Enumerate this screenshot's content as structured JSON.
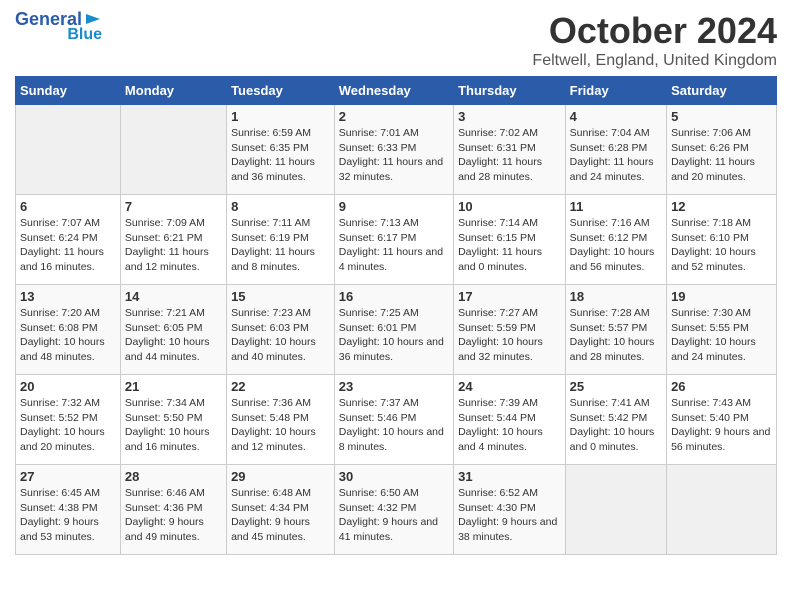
{
  "header": {
    "logo_line1": "General",
    "logo_line2": "Blue",
    "title": "October 2024",
    "subtitle": "Feltwell, England, United Kingdom"
  },
  "weekdays": [
    "Sunday",
    "Monday",
    "Tuesday",
    "Wednesday",
    "Thursday",
    "Friday",
    "Saturday"
  ],
  "weeks": [
    [
      {
        "day": "",
        "empty": true
      },
      {
        "day": "",
        "empty": true
      },
      {
        "day": "1",
        "sunrise": "6:59 AM",
        "sunset": "6:35 PM",
        "daylight": "11 hours and 36 minutes."
      },
      {
        "day": "2",
        "sunrise": "7:01 AM",
        "sunset": "6:33 PM",
        "daylight": "11 hours and 32 minutes."
      },
      {
        "day": "3",
        "sunrise": "7:02 AM",
        "sunset": "6:31 PM",
        "daylight": "11 hours and 28 minutes."
      },
      {
        "day": "4",
        "sunrise": "7:04 AM",
        "sunset": "6:28 PM",
        "daylight": "11 hours and 24 minutes."
      },
      {
        "day": "5",
        "sunrise": "7:06 AM",
        "sunset": "6:26 PM",
        "daylight": "11 hours and 20 minutes."
      }
    ],
    [
      {
        "day": "6",
        "sunrise": "7:07 AM",
        "sunset": "6:24 PM",
        "daylight": "11 hours and 16 minutes."
      },
      {
        "day": "7",
        "sunrise": "7:09 AM",
        "sunset": "6:21 PM",
        "daylight": "11 hours and 12 minutes."
      },
      {
        "day": "8",
        "sunrise": "7:11 AM",
        "sunset": "6:19 PM",
        "daylight": "11 hours and 8 minutes."
      },
      {
        "day": "9",
        "sunrise": "7:13 AM",
        "sunset": "6:17 PM",
        "daylight": "11 hours and 4 minutes."
      },
      {
        "day": "10",
        "sunrise": "7:14 AM",
        "sunset": "6:15 PM",
        "daylight": "11 hours and 0 minutes."
      },
      {
        "day": "11",
        "sunrise": "7:16 AM",
        "sunset": "6:12 PM",
        "daylight": "10 hours and 56 minutes."
      },
      {
        "day": "12",
        "sunrise": "7:18 AM",
        "sunset": "6:10 PM",
        "daylight": "10 hours and 52 minutes."
      }
    ],
    [
      {
        "day": "13",
        "sunrise": "7:20 AM",
        "sunset": "6:08 PM",
        "daylight": "10 hours and 48 minutes."
      },
      {
        "day": "14",
        "sunrise": "7:21 AM",
        "sunset": "6:05 PM",
        "daylight": "10 hours and 44 minutes."
      },
      {
        "day": "15",
        "sunrise": "7:23 AM",
        "sunset": "6:03 PM",
        "daylight": "10 hours and 40 minutes."
      },
      {
        "day": "16",
        "sunrise": "7:25 AM",
        "sunset": "6:01 PM",
        "daylight": "10 hours and 36 minutes."
      },
      {
        "day": "17",
        "sunrise": "7:27 AM",
        "sunset": "5:59 PM",
        "daylight": "10 hours and 32 minutes."
      },
      {
        "day": "18",
        "sunrise": "7:28 AM",
        "sunset": "5:57 PM",
        "daylight": "10 hours and 28 minutes."
      },
      {
        "day": "19",
        "sunrise": "7:30 AM",
        "sunset": "5:55 PM",
        "daylight": "10 hours and 24 minutes."
      }
    ],
    [
      {
        "day": "20",
        "sunrise": "7:32 AM",
        "sunset": "5:52 PM",
        "daylight": "10 hours and 20 minutes."
      },
      {
        "day": "21",
        "sunrise": "7:34 AM",
        "sunset": "5:50 PM",
        "daylight": "10 hours and 16 minutes."
      },
      {
        "day": "22",
        "sunrise": "7:36 AM",
        "sunset": "5:48 PM",
        "daylight": "10 hours and 12 minutes."
      },
      {
        "day": "23",
        "sunrise": "7:37 AM",
        "sunset": "5:46 PM",
        "daylight": "10 hours and 8 minutes."
      },
      {
        "day": "24",
        "sunrise": "7:39 AM",
        "sunset": "5:44 PM",
        "daylight": "10 hours and 4 minutes."
      },
      {
        "day": "25",
        "sunrise": "7:41 AM",
        "sunset": "5:42 PM",
        "daylight": "10 hours and 0 minutes."
      },
      {
        "day": "26",
        "sunrise": "7:43 AM",
        "sunset": "5:40 PM",
        "daylight": "9 hours and 56 minutes."
      }
    ],
    [
      {
        "day": "27",
        "sunrise": "6:45 AM",
        "sunset": "4:38 PM",
        "daylight": "9 hours and 53 minutes."
      },
      {
        "day": "28",
        "sunrise": "6:46 AM",
        "sunset": "4:36 PM",
        "daylight": "9 hours and 49 minutes."
      },
      {
        "day": "29",
        "sunrise": "6:48 AM",
        "sunset": "4:34 PM",
        "daylight": "9 hours and 45 minutes."
      },
      {
        "day": "30",
        "sunrise": "6:50 AM",
        "sunset": "4:32 PM",
        "daylight": "9 hours and 41 minutes."
      },
      {
        "day": "31",
        "sunrise": "6:52 AM",
        "sunset": "4:30 PM",
        "daylight": "9 hours and 38 minutes."
      },
      {
        "day": "",
        "empty": true
      },
      {
        "day": "",
        "empty": true
      }
    ]
  ],
  "labels": {
    "sunrise_prefix": "Sunrise: ",
    "sunset_prefix": "Sunset: ",
    "daylight_prefix": "Daylight: "
  }
}
